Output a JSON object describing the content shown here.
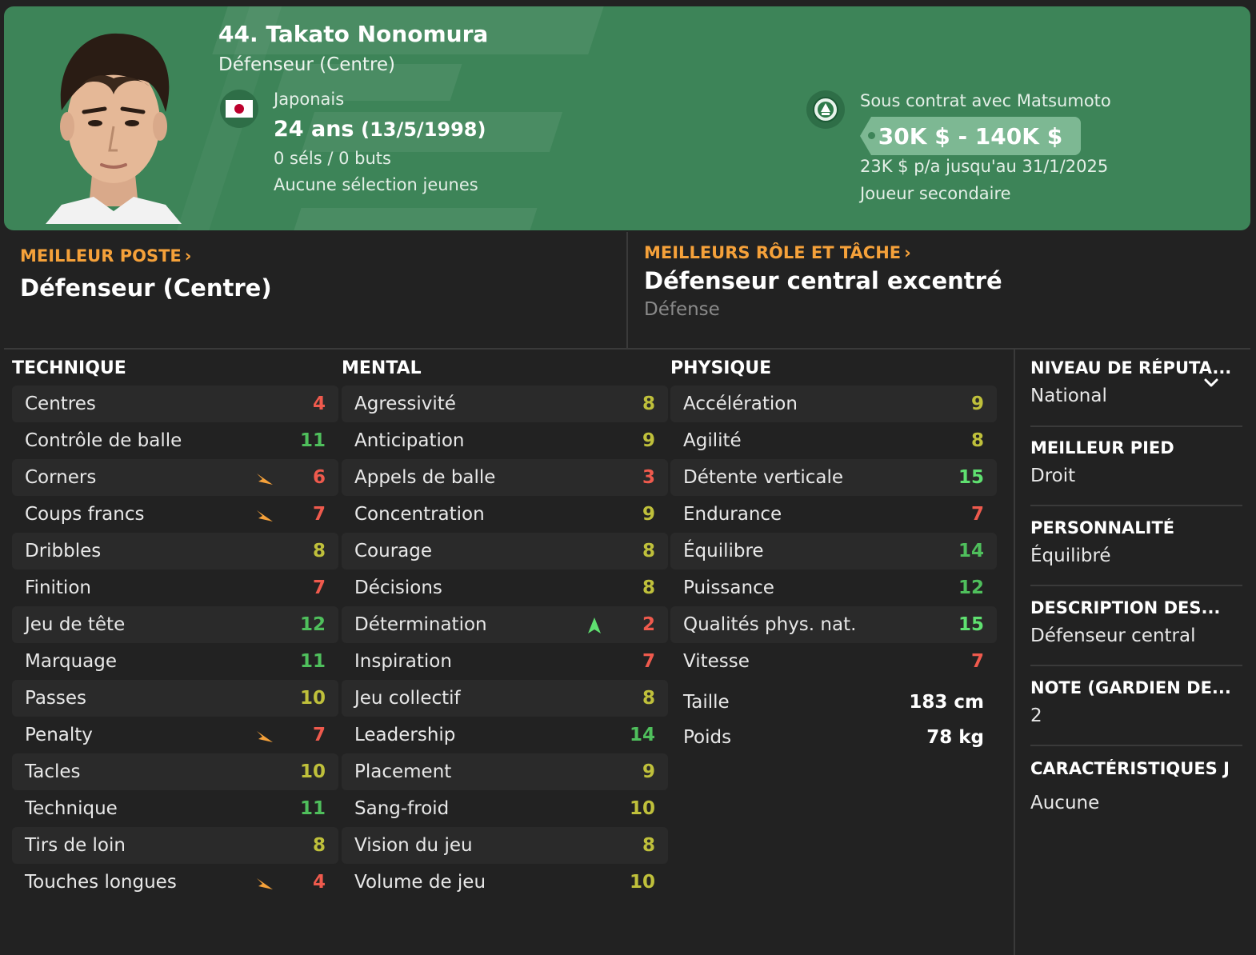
{
  "player": {
    "name": "44. Takato Nonomura",
    "position": "Défenseur (Centre)",
    "nationality": "Japonais",
    "age": "24 ans",
    "dob": "(13/5/1998)",
    "caps": "0 séls / 0 buts",
    "youth": "Aucune sélection jeunes"
  },
  "contract": {
    "title": "Sous contrat avec Matsumoto",
    "wage_range": "30K $ - 140K $",
    "salary": "23K $ p/a jusqu'au 31/1/2025",
    "status": "Joueur secondaire"
  },
  "best": {
    "position_label": "MEILLEUR POSTE",
    "position_value": "Défenseur (Centre)",
    "role_label": "MEILLEURS RÔLE ET TÂCHE",
    "role_value": "Défenseur central excentré",
    "role_duty": "Défense"
  },
  "technique": {
    "title": "TECHNIQUE",
    "rows": [
      {
        "label": "Centres",
        "value": "4",
        "color": "red",
        "flag": false
      },
      {
        "label": "Contrôle de balle",
        "value": "11",
        "color": "green",
        "flag": false
      },
      {
        "label": "Corners",
        "value": "6",
        "color": "red",
        "flag": true
      },
      {
        "label": "Coups francs",
        "value": "7",
        "color": "red",
        "flag": true
      },
      {
        "label": "Dribbles",
        "value": "8",
        "color": "yellow",
        "flag": false
      },
      {
        "label": "Finition",
        "value": "7",
        "color": "red",
        "flag": false
      },
      {
        "label": "Jeu de tête",
        "value": "12",
        "color": "green",
        "flag": false
      },
      {
        "label": "Marquage",
        "value": "11",
        "color": "green",
        "flag": false
      },
      {
        "label": "Passes",
        "value": "10",
        "color": "yellow",
        "flag": false
      },
      {
        "label": "Penalty",
        "value": "7",
        "color": "red",
        "flag": true
      },
      {
        "label": "Tacles",
        "value": "10",
        "color": "yellow",
        "flag": false
      },
      {
        "label": "Technique",
        "value": "11",
        "color": "green",
        "flag": false
      },
      {
        "label": "Tirs de loin",
        "value": "8",
        "color": "yellow",
        "flag": false
      },
      {
        "label": "Touches longues",
        "value": "4",
        "color": "red",
        "flag": true
      }
    ]
  },
  "mental": {
    "title": "MENTAL",
    "rows": [
      {
        "label": "Agressivité",
        "value": "8",
        "color": "yellow",
        "flag": false
      },
      {
        "label": "Anticipation",
        "value": "9",
        "color": "yellow",
        "flag": false
      },
      {
        "label": "Appels de balle",
        "value": "3",
        "color": "red",
        "flag": false
      },
      {
        "label": "Concentration",
        "value": "9",
        "color": "yellow",
        "flag": false
      },
      {
        "label": "Courage",
        "value": "8",
        "color": "yellow",
        "flag": false
      },
      {
        "label": "Décisions",
        "value": "8",
        "color": "yellow",
        "flag": false
      },
      {
        "label": "Détermination",
        "value": "2",
        "color": "red",
        "flag": false,
        "up": true
      },
      {
        "label": "Inspiration",
        "value": "7",
        "color": "red",
        "flag": false
      },
      {
        "label": "Jeu collectif",
        "value": "8",
        "color": "yellow",
        "flag": false
      },
      {
        "label": "Leadership",
        "value": "14",
        "color": "green",
        "flag": false
      },
      {
        "label": "Placement",
        "value": "9",
        "color": "yellow",
        "flag": false
      },
      {
        "label": "Sang-froid",
        "value": "10",
        "color": "yellow",
        "flag": false
      },
      {
        "label": "Vision du jeu",
        "value": "8",
        "color": "yellow",
        "flag": false
      },
      {
        "label": "Volume de jeu",
        "value": "10",
        "color": "yellow",
        "flag": false
      }
    ]
  },
  "physique": {
    "title": "PHYSIQUE",
    "rows": [
      {
        "label": "Accélération",
        "value": "9",
        "color": "yellow",
        "flag": false
      },
      {
        "label": "Agilité",
        "value": "8",
        "color": "yellow",
        "flag": false
      },
      {
        "label": "Détente verticale",
        "value": "15",
        "color": "bright",
        "flag": false
      },
      {
        "label": "Endurance",
        "value": "7",
        "color": "red",
        "flag": false
      },
      {
        "label": "Équilibre",
        "value": "14",
        "color": "green",
        "flag": false
      },
      {
        "label": "Puissance",
        "value": "12",
        "color": "green",
        "flag": false
      },
      {
        "label": "Qualités phys. nat.",
        "value": "15",
        "color": "bright",
        "flag": false
      },
      {
        "label": "Vitesse",
        "value": "7",
        "color": "red",
        "flag": false
      }
    ],
    "height_label": "Taille",
    "height_value": "183 cm",
    "weight_label": "Poids",
    "weight_value": "78 kg"
  },
  "side": {
    "reputation_title": "NIVEAU DE RÉPUTA...",
    "reputation_value": "National",
    "foot_title": "MEILLEUR PIED",
    "foot_value": "Droit",
    "personality_title": "PERSONNALITÉ",
    "personality_value": "Équilibré",
    "media_title": "DESCRIPTION DES...",
    "media_value": "Défenseur central",
    "gk_title": "NOTE (GARDIEN DE...",
    "gk_value": "2",
    "traits_title": "CARACTÉRISTIQUES J",
    "traits_value": "Aucune"
  },
  "colors": {
    "header_green": "#3d8458",
    "accent_orange": "#f5a13a",
    "attr_red": "#ef5a4d",
    "attr_yellow": "#bfc03b",
    "attr_green": "#4fbf5c",
    "attr_bright": "#5fe070"
  }
}
